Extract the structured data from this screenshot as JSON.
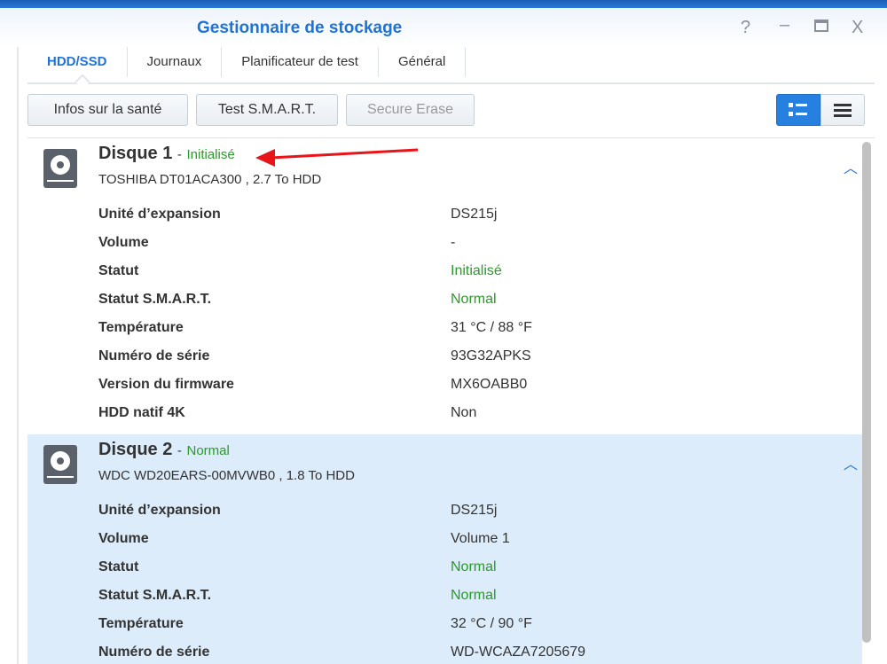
{
  "window": {
    "title": "Gestionnaire de stockage",
    "help": "?",
    "minimize": "–",
    "maximize": "▭",
    "close": "X"
  },
  "tabs": [
    {
      "label": "HDD/SSD"
    },
    {
      "label": "Journaux"
    },
    {
      "label": "Planificateur de test"
    },
    {
      "label": "Général"
    }
  ],
  "toolbar": {
    "health": "Infos sur la santé",
    "smart": "Test S.M.A.R.T.",
    "erase": "Secure Erase"
  },
  "colors": {
    "accent": "#1f73d6",
    "ok": "#2a9a2a",
    "annotation": "#e8141a"
  },
  "disks": [
    {
      "name": "Disque 1",
      "sep": "-",
      "status": "Initialisé",
      "model": "TOSHIBA DT01ACA300 , 2.7 To HDD",
      "rows": [
        {
          "k": "Unité d’expansion",
          "v": "DS215j"
        },
        {
          "k": "Volume",
          "v": "-"
        },
        {
          "k": "Statut",
          "v": "Initialisé",
          "green": true
        },
        {
          "k": "Statut S.M.A.R.T.",
          "v": "Normal",
          "green": true
        },
        {
          "k": "Température",
          "v": "31 °C / 88 °F"
        },
        {
          "k": "Numéro de série",
          "v": "93G32APKS"
        },
        {
          "k": "Version du firmware",
          "v": "MX6OABB0"
        },
        {
          "k": "HDD natif 4K",
          "v": "Non"
        }
      ]
    },
    {
      "name": "Disque 2",
      "sep": "-",
      "status": "Normal",
      "model": "WDC WD20EARS-00MVWB0 , 1.8 To HDD",
      "rows": [
        {
          "k": "Unité d’expansion",
          "v": "DS215j"
        },
        {
          "k": "Volume",
          "v": "Volume 1"
        },
        {
          "k": "Statut",
          "v": "Normal",
          "green": true
        },
        {
          "k": "Statut S.M.A.R.T.",
          "v": "Normal",
          "green": true
        },
        {
          "k": "Température",
          "v": "32 °C / 90 °F"
        },
        {
          "k": "Numéro de série",
          "v": "WD-WCAZA7205679"
        }
      ]
    }
  ]
}
